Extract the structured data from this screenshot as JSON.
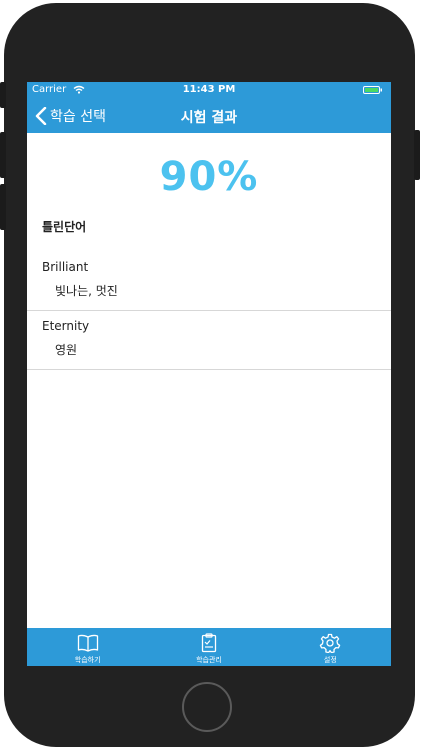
{
  "status": {
    "carrier": "Carrier",
    "time": "11:43 PM"
  },
  "nav": {
    "back_label": "학습 선택",
    "title": "시험 결과"
  },
  "result": {
    "score": "90%",
    "section_title": "틀린단어"
  },
  "wrong_words": [
    {
      "term": "Brilliant",
      "meaning": "빛나는, 멋진"
    },
    {
      "term": "Eternity",
      "meaning": "영원"
    }
  ],
  "tabs": [
    {
      "label": "학습하기",
      "icon": "book-icon"
    },
    {
      "label": "학습관리",
      "icon": "clipboard-icon"
    },
    {
      "label": "설정",
      "icon": "gear-icon"
    }
  ],
  "colors": {
    "accent": "#2d9ad8",
    "score": "#4cc2ef"
  }
}
